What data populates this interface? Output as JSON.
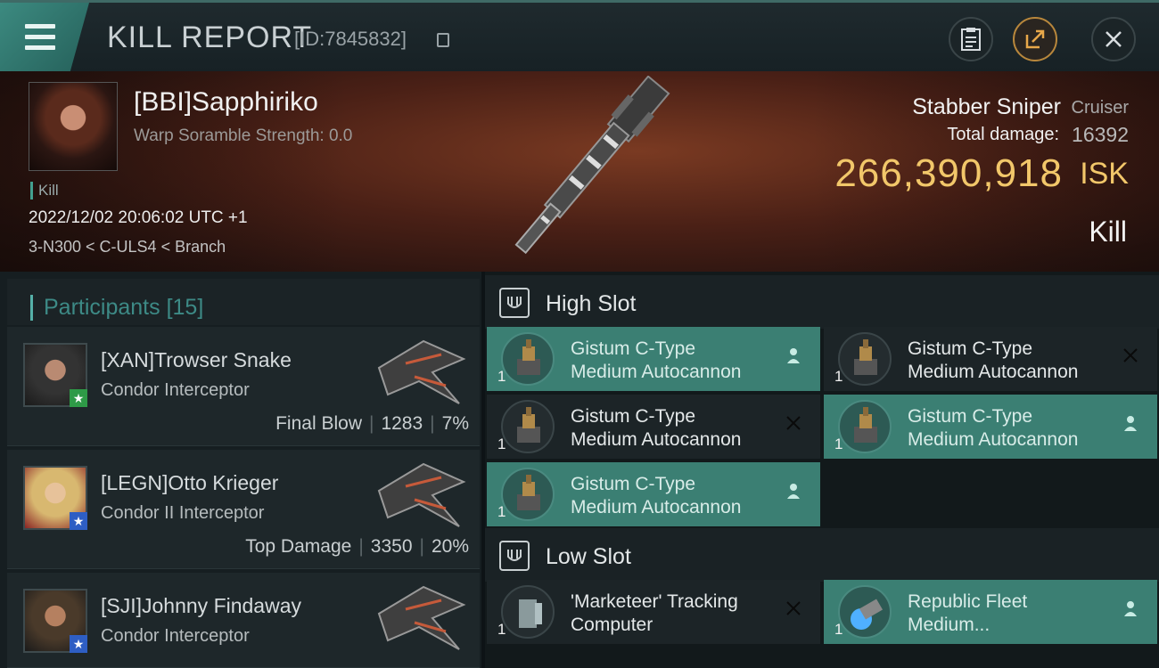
{
  "header": {
    "title": "KILL REPORT",
    "report_id": "[ID:7845832]"
  },
  "victim": {
    "name": "[BBI]Sapphiriko",
    "warp_scramble": "Warp Soramble Strength: 0.0",
    "tag": "Kill",
    "datetime": "2022/12/02 20:06:02 UTC +1",
    "location": "3-N300 < C-ULS4 < Branch",
    "ship_name": "Stabber Sniper",
    "ship_class": "Cruiser",
    "damage_label": "Total damage:",
    "damage_value": "16392",
    "isk_value": "266,390,918",
    "isk_unit": "ISK",
    "result": "Kill"
  },
  "participants": {
    "label": "Participants",
    "count": "[15]",
    "items": [
      {
        "name": "[XAN]Trowser Snake",
        "ship": "Condor Interceptor",
        "role": "Final Blow",
        "damage": "1283",
        "percent": "7%",
        "badge": "★"
      },
      {
        "name": "[LEGN]Otto Krieger",
        "ship": "Condor II Interceptor",
        "role": "Top Damage",
        "damage": "3350",
        "percent": "20%",
        "badge": "★"
      },
      {
        "name": "[SJI]Johnny Findaway",
        "ship": "Condor Interceptor",
        "role": "",
        "damage": "",
        "percent": "",
        "badge": "★"
      }
    ]
  },
  "high_slot": {
    "title": "High Slot",
    "modules": [
      {
        "line1": "Gistum C-Type",
        "line2": "Medium Autocannon",
        "qty": "1",
        "state": "dropped"
      },
      {
        "line1": "Gistum C-Type",
        "line2": "Medium Autocannon",
        "qty": "1",
        "state": "destroyed"
      },
      {
        "line1": "Gistum C-Type",
        "line2": "Medium Autocannon",
        "qty": "1",
        "state": "destroyed"
      },
      {
        "line1": "Gistum C-Type",
        "line2": "Medium Autocannon",
        "qty": "1",
        "state": "dropped"
      },
      {
        "line1": "Gistum C-Type",
        "line2": "Medium Autocannon",
        "qty": "1",
        "state": "dropped"
      }
    ]
  },
  "low_slot": {
    "title": "Low Slot",
    "modules": [
      {
        "line1": "'Marketeer' Tracking",
        "line2": "Computer",
        "qty": "1",
        "state": "destroyed"
      },
      {
        "line1": "Republic Fleet",
        "line2": "Medium...",
        "qty": "1",
        "state": "dropped"
      }
    ]
  },
  "colors": {
    "accent": "#3b7f73",
    "isk": "#f2c76a",
    "participants_title": "#3d8a86"
  }
}
